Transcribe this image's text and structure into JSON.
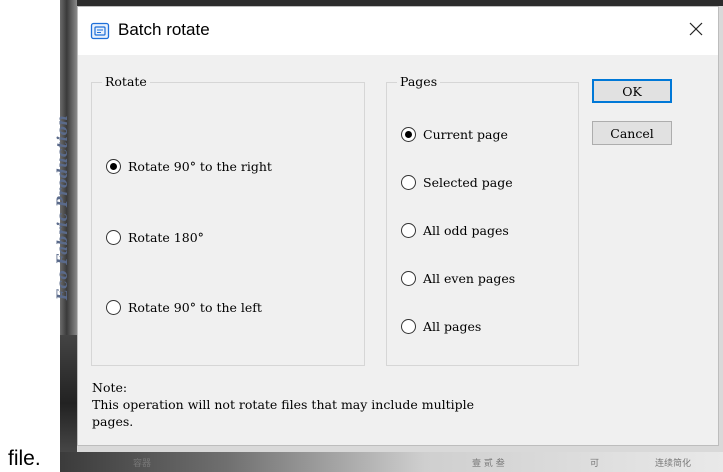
{
  "background": {
    "side_text": "Eco Fabric Production",
    "bottom_fragments": [
      "容器",
      "壹 贰 叁",
      "可",
      "连续简化"
    ]
  },
  "outside_label": "file.",
  "dialog": {
    "title": "Batch rotate",
    "title_icon": "batch-rotate-icon",
    "close_symbol": "✕",
    "rotate_group": {
      "title": "Rotate",
      "options": [
        {
          "label": "Rotate 90°  to the right",
          "checked": true
        },
        {
          "label": "Rotate 180°",
          "checked": false
        },
        {
          "label": "Rotate 90°  to the left",
          "checked": false
        }
      ]
    },
    "pages_group": {
      "title": "Pages",
      "options": [
        {
          "label": "Current page",
          "checked": true
        },
        {
          "label": "Selected page",
          "checked": false
        },
        {
          "label": "All odd pages",
          "checked": false
        },
        {
          "label": "All even pages",
          "checked": false
        },
        {
          "label": "All pages",
          "checked": false
        }
      ]
    },
    "buttons": {
      "ok": "OK",
      "cancel": "Cancel"
    },
    "note": {
      "heading": "Note:",
      "line1": "This operation will not rotate files that may include multiple",
      "line2": "pages."
    }
  },
  "colors": {
    "dialog_bg": "#f0f0f0",
    "titlebar_bg": "#ffffff",
    "accent": "#0078d7",
    "icon_blue": "#1e6fd9"
  }
}
